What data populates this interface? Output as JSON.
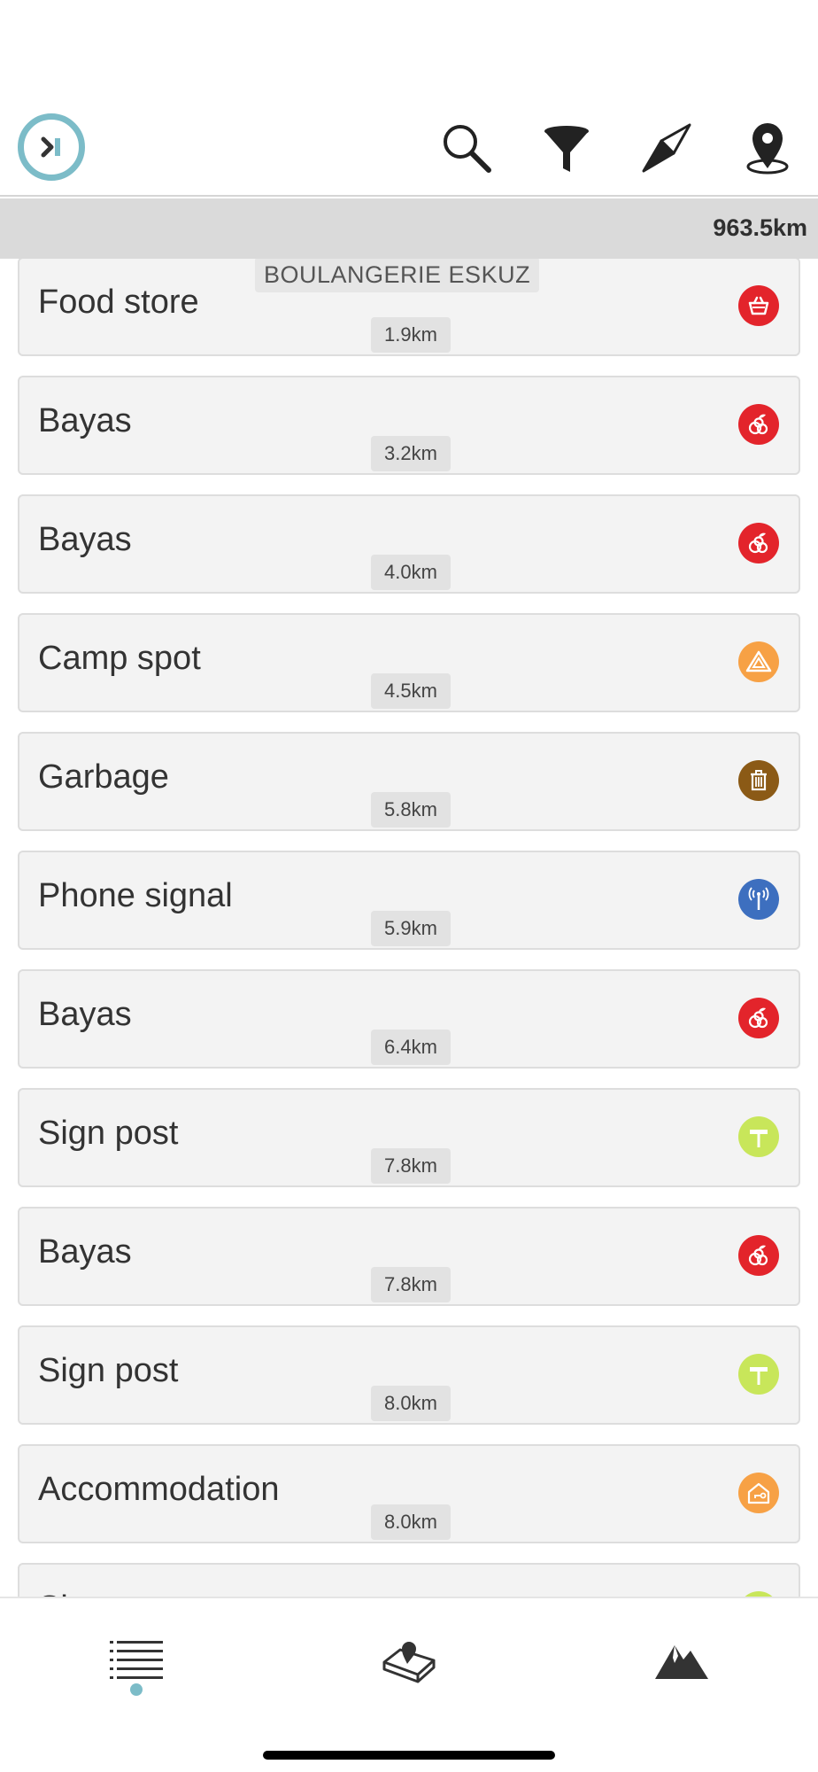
{
  "header": {
    "total_distance": "963.5km"
  },
  "poi_list": [
    {
      "name": "Food store",
      "subtitle": "BOULANGERIE ESKUZ",
      "distance": "1.9km",
      "icon": "basket-icon",
      "color": "#e3242b"
    },
    {
      "name": "Bayas",
      "distance": "3.2km",
      "icon": "berries-icon",
      "color": "#e3242b"
    },
    {
      "name": "Bayas",
      "distance": "4.0km",
      "icon": "berries-icon",
      "color": "#e3242b"
    },
    {
      "name": "Camp spot",
      "distance": "4.5km",
      "icon": "tent-icon",
      "color": "#f7a145"
    },
    {
      "name": "Garbage",
      "distance": "5.8km",
      "icon": "trash-icon",
      "color": "#8b5a16"
    },
    {
      "name": "Phone signal",
      "distance": "5.9km",
      "icon": "antenna-icon",
      "color": "#3d6fbf"
    },
    {
      "name": "Bayas",
      "distance": "6.4km",
      "icon": "berries-icon",
      "color": "#e3242b"
    },
    {
      "name": "Sign post",
      "distance": "7.8km",
      "icon": "signpost-icon",
      "color": "#c8e65a"
    },
    {
      "name": "Bayas",
      "distance": "7.8km",
      "icon": "berries-icon",
      "color": "#e3242b"
    },
    {
      "name": "Sign post",
      "distance": "8.0km",
      "icon": "signpost-icon",
      "color": "#c8e65a"
    },
    {
      "name": "Accommodation",
      "distance": "8.0km",
      "icon": "house-key-icon",
      "color": "#f7a145"
    },
    {
      "name": "Sign post",
      "distance": "",
      "icon": "signpost-icon",
      "color": "#c8e65a"
    }
  ],
  "colors": {
    "accent": "#7cbcc8",
    "card_bg": "#f3f3f3",
    "distance_bar_bg": "#dadada"
  },
  "top_icons": [
    "collapse-panel-icon",
    "search-icon",
    "filter-icon",
    "compass-icon",
    "location-pin-icon"
  ],
  "bottom_nav": [
    "list-icon",
    "map-icon",
    "elevation-icon"
  ]
}
